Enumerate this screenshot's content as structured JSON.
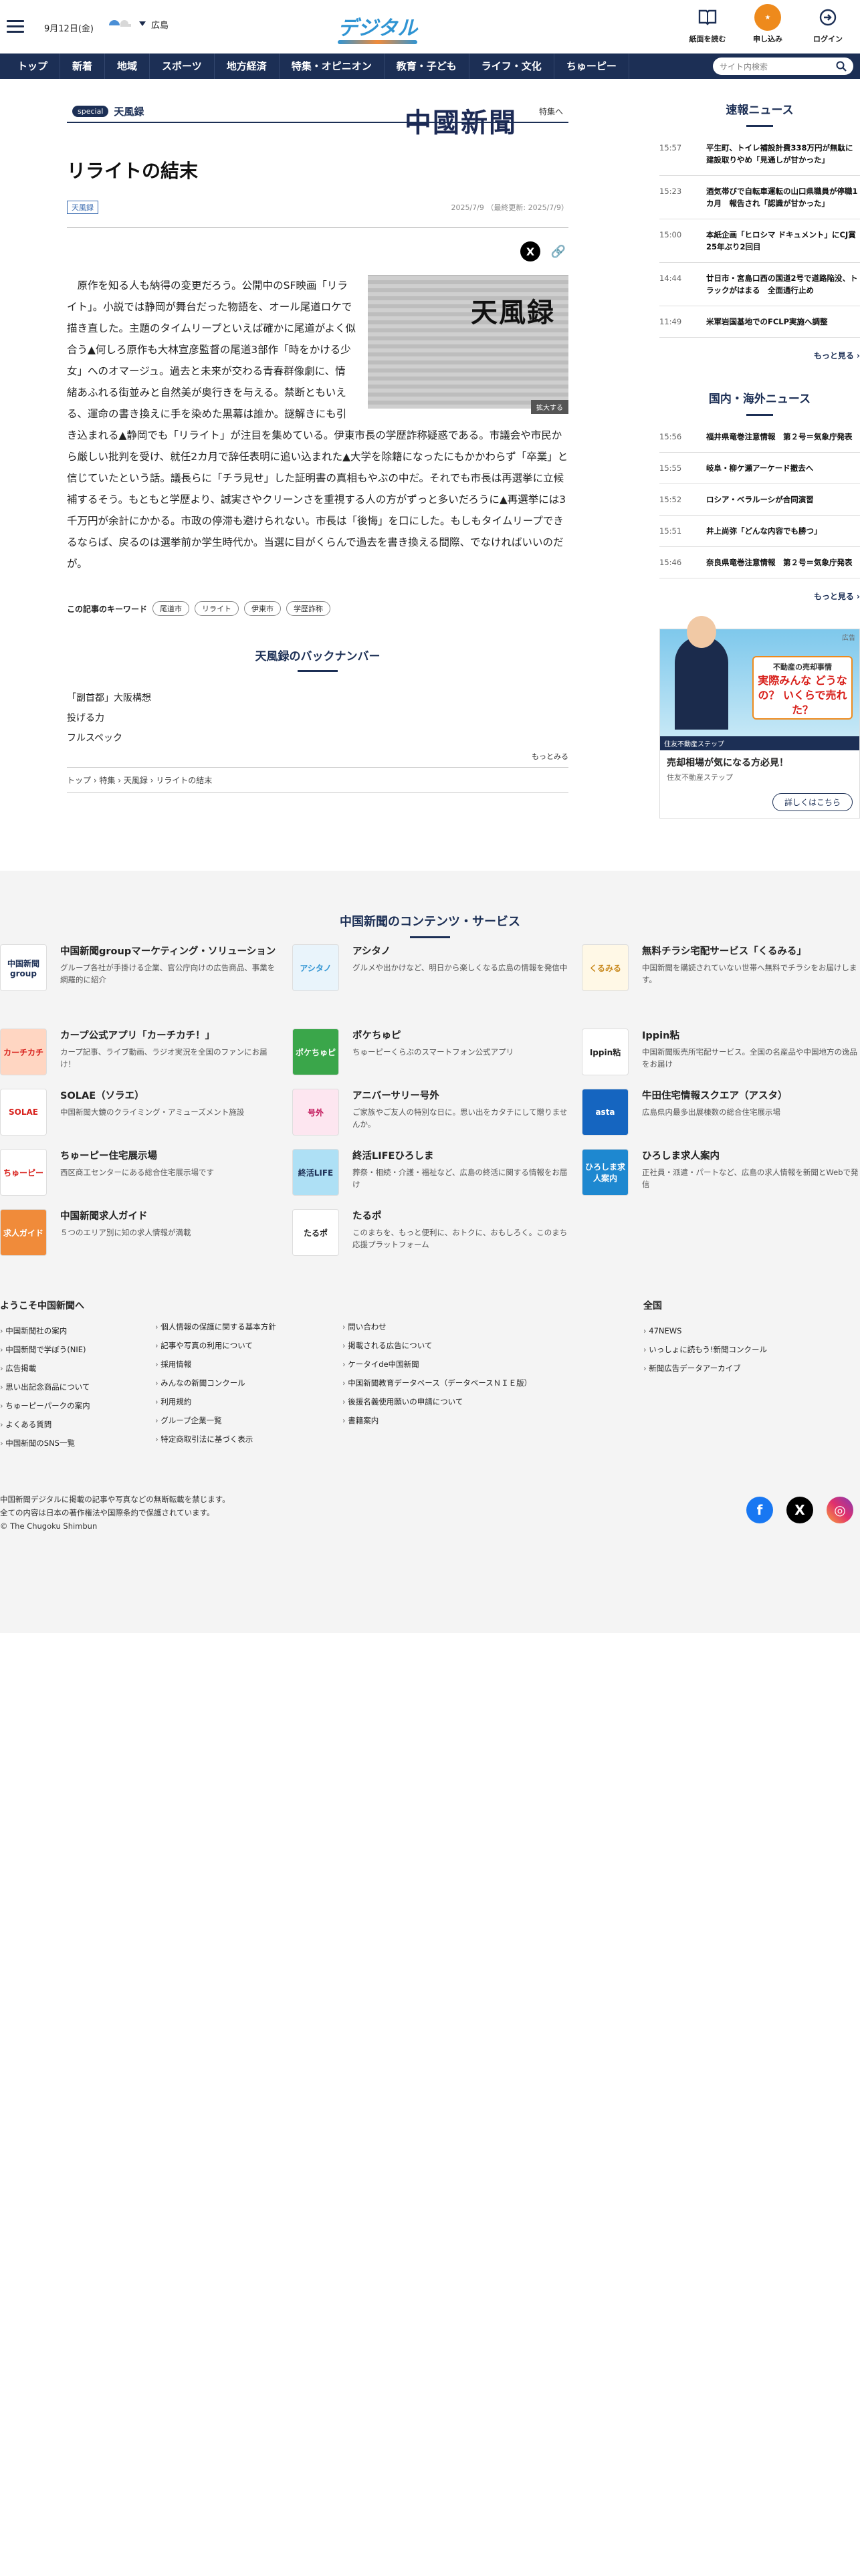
{
  "header": {
    "date": "9月12日(金)",
    "weather_area": "広島",
    "logo_main": "中國新聞",
    "logo_sub": "デジタル",
    "icons": [
      {
        "label": "紙面を読む",
        "icon": "newspaper-icon"
      },
      {
        "label": "申し込み",
        "icon": "subscribe-icon"
      },
      {
        "label": "ログイン",
        "icon": "login-icon"
      }
    ]
  },
  "nav": {
    "items": [
      "トップ",
      "新着",
      "地域",
      "スポーツ",
      "地方経済",
      "特集・オピニオン",
      "教育・子ども",
      "ライフ・文化",
      "ちゅーピー"
    ],
    "search_placeholder": "サイト内検索"
  },
  "section": {
    "badge": "special",
    "name": "天風録",
    "link": "特集へ"
  },
  "article": {
    "title": "リライトの結末",
    "tag": "天風録",
    "dates": "2025/7/9 （最終更新: 2025/7/9）",
    "figure_text": "天風録",
    "enlarge": "拡大する",
    "body": "原作を知る人も納得の変更だろう。公開中のSF映画「リライト」。小説では静岡が舞台だった物語を、オール尾道ロケで描き直した。主題のタイムリープといえば確かに尾道がよく似合う▲何しろ原作も大林宣彦監督の尾道3部作「時をかける少女」へのオマージュ。過去と未来が交わる青春群像劇に、情緒あふれる街並みと自然美が奥行きを与える。禁断ともいえる、運命の書き換えに手を染めた黒幕は誰か。謎解きにも引き込まれる▲静岡でも「リライト」が注目を集めている。伊東市長の学歴詐称疑惑である。市議会や市民から厳しい批判を受け、就任2カ月で辞任表明に追い込まれた▲大学を除籍になったにもかかわらず「卒業」と信じていたという話。議長らに「チラ見せ」した証明書の真相もやぶの中だ。それでも市長は再選挙に立候補するそう。もともと学歴より、誠実さやクリーンさを重視する人の方がずっと多いだろうに▲再選挙には3千万円が余計にかかる。市政の停滞も避けられない。市長は「後悔」を口にした。もしもタイムリープできるならば、戻るのは選挙前か学生時代か。当選に目がくらんで過去を書き換える間際、でなければいいのだが。",
    "keywords_label": "この記事のキーワード",
    "keywords": [
      "尾道市",
      "リライト",
      "伊東市",
      "学歴詐称"
    ]
  },
  "backnumber": {
    "heading": "天風録のバックナンバー",
    "items": [
      "「副首都」大阪構想",
      "投げる力",
      "フルスペック"
    ],
    "more": "もっとみる"
  },
  "breadcrumb": "トップ › 特集 › 天風録 › リライトの結末",
  "sidebar": {
    "breaking": {
      "heading": "速報ニュース",
      "items": [
        {
          "time": "15:57",
          "title": "平生町、トイレ補設計費338万円が無駄に　建設取りやめ「見通しが甘かった」"
        },
        {
          "time": "15:23",
          "title": "酒気帯びで自転車運転の山口県職員が停職1カ月　報告され「認識が甘かった」"
        },
        {
          "time": "15:00",
          "title": "本紙企画「ヒロシマ ドキュメント」にCJ賞　25年ぶり2回目"
        },
        {
          "time": "14:44",
          "title": "廿日市・宮島口西の国道2号で道路陥没、トラックがはまる　全面通行止め"
        },
        {
          "time": "11:49",
          "title": "米軍岩国基地でのFCLP実施へ調整"
        }
      ],
      "more": "もっと見る"
    },
    "domestic": {
      "heading": "国内・海外ニュース",
      "items": [
        {
          "time": "15:56",
          "title": "福井県竜巻注意情報　第２号＝気象庁発表"
        },
        {
          "time": "15:55",
          "title": "岐阜・柳ケ瀬アーケード撤去へ"
        },
        {
          "time": "15:52",
          "title": "ロシア・ベラルーシが合同演習"
        },
        {
          "time": "15:51",
          "title": "井上尚弥「どんな内容でも勝つ」"
        },
        {
          "time": "15:46",
          "title": "奈良県竜巻注意情報　第２号＝気象庁発表"
        }
      ],
      "more": "もっと見る"
    },
    "ad": {
      "label": "広告",
      "bubble_top": "不動産の売却事情",
      "bubble_main": "実際みんな どうなの？ いくらで売れた？",
      "strip": "住友不動産ステップ",
      "caption": "売却相場が気になる方必見！",
      "sub": "住友不動産ステップ",
      "button": "詳しくはこちら"
    }
  },
  "footer": {
    "heading": "中国新聞のコンテンツ・サービス",
    "services": [
      {
        "name": "中国新聞groupマーケティング・ソリューション",
        "desc": "グループ各社が手掛ける企業、官公庁向けの広告商品、事業を網羅的に紹介",
        "logo": "中国新聞group",
        "color": "#ffffff",
        "fg": "#1c2f55"
      },
      {
        "name": "アシタノ",
        "desc": "グルメや出かけなど、明日から楽しくなる広島の情報を発信中",
        "logo": "アシタノ",
        "color": "#e9f4fb",
        "fg": "#2f94d3"
      },
      {
        "name": "無料チラシ宅配サービス「くるみる」",
        "desc": "中国新聞を購読されていない世帯へ無料でチラシをお届けします。",
        "logo": "くるみる",
        "color": "#fff8e6",
        "fg": "#c8881c"
      },
      {
        "name": "カープ公式アプリ「カーチカチ！」",
        "desc": "カープ記事、ライブ動画、ラジオ実況を全国のファンにお届け！",
        "logo": "カーチカチ",
        "color": "#ffd6c2",
        "fg": "#d8211c"
      },
      {
        "name": "ポケちゅピ",
        "desc": "ちゅーピーくらぶのスマートフォン公式アプリ",
        "logo": "ポケちゅピ",
        "color": "#3aa64a",
        "fg": "#ffffff"
      },
      {
        "name": "Ippin粘",
        "desc": "中国新聞販売所宅配サービス。全国の名産品や中国地方の逸品をお届け",
        "logo": "Ippin粘",
        "color": "#ffffff",
        "fg": "#222222"
      },
      {
        "name": "SOLAE（ソラエ）",
        "desc": "中国新聞大鏡のクライミング・アミューズメント施設",
        "logo": "SOLAE",
        "color": "#ffffff",
        "fg": "#d8211c"
      },
      {
        "name": "アニバーサリー号外",
        "desc": "ご家族やご友人の特別な日に。思い出をカタチにして贈りませんか。",
        "logo": "号外",
        "color": "#fde6f0",
        "fg": "#c2185b"
      },
      {
        "name": "牛田住宅情報スクエア（アスタ）",
        "desc": "広島県内最多出展棟数の総合住宅展示場",
        "logo": "asta",
        "color": "#1565c0",
        "fg": "#ffffff"
      },
      {
        "name": "ちゅーピー住宅展示場",
        "desc": "西区商工センターにある総合住宅展示場です",
        "logo": "ちゅーピー",
        "color": "#ffffff",
        "fg": "#d8211c"
      },
      {
        "name": "終活LIFEひろしま",
        "desc": "葬祭・相続・介護・福祉など、広島の終活に関する情報をお届け",
        "logo": "終活LIFE",
        "color": "#aee0f5",
        "fg": "#1c2f55"
      },
      {
        "name": "ひろしま求人案内",
        "desc": "正社員・派遣・パートなど、広島の求人情報を新聞とWebで発信",
        "logo": "ひろしま求人案内",
        "color": "#1e88d0",
        "fg": "#ffffff"
      },
      {
        "name": "中国新聞求人ガイド",
        "desc": "５つのエリア別に知の求人情報が満載",
        "logo": "求人ガイド",
        "color": "#f08b3a",
        "fg": "#ffffff"
      },
      {
        "name": "たるポ",
        "desc": "このまちを、もっと便利に、おトクに、おもしろく。このまち応援プラットフォーム",
        "logo": "たるポ",
        "color": "#ffffff",
        "fg": "#222222"
      }
    ],
    "welcome": {
      "heading": "ようこそ中国新聞へ",
      "col1": [
        "中国新聞社の案内",
        "中国新聞で学ぼう(NIE)",
        "広告掲載",
        "思い出記念商品について",
        "ちゅーピーパークの案内",
        "よくある質問",
        "中国新聞のSNS一覧"
      ],
      "col2": [
        "個人情報の保護に関する基本方針",
        "記事や写真の利用について",
        "採用情報",
        "みんなの新聞コンクール",
        "利用規約",
        "グループ企業一覧",
        "特定商取引法に基づく表示"
      ],
      "col3": [
        "問い合わせ",
        "掲載される広告について",
        "ケータイde中国新聞",
        "中国新聞教育データベース（データベースＮＩＥ版）",
        "後援名義使用願いの申請について",
        "書籍案内"
      ]
    },
    "national": {
      "heading": "全国",
      "items": [
        "47NEWS",
        "いっしょに読もう!新聞コンクール",
        "新聞広告データアーカイブ"
      ]
    },
    "copyright": [
      "中国新聞デジタルに掲載の記事や写真などの無断転載を禁じます。",
      "全ての内容は日本の著作権法や国際条約で保護されています。",
      "© The Chugoku Shimbun"
    ]
  },
  "colors": {
    "navy": "#1c2f55",
    "accent_orange": "#ee8a1c",
    "logo_blue": "#2f94d3"
  }
}
